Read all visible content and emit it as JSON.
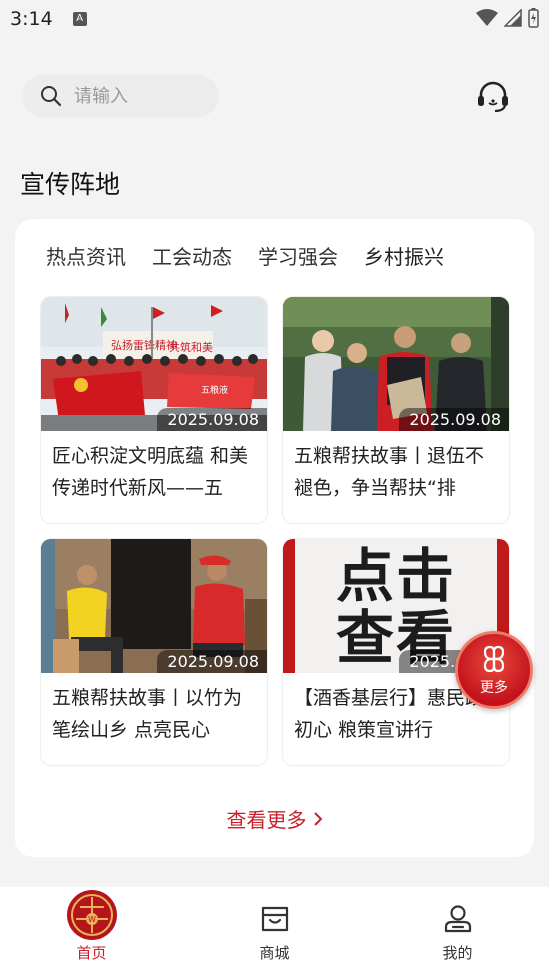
{
  "status_bar": {
    "time": "3:14",
    "notif_icon": "A"
  },
  "search": {
    "placeholder": "请输入"
  },
  "section": {
    "title": "宣传阵地"
  },
  "tabs": [
    {
      "label": "热点资讯",
      "active": false
    },
    {
      "label": "工会动态",
      "active": false
    },
    {
      "label": "学习强会",
      "active": false
    },
    {
      "label": "乡村振兴",
      "active": true
    }
  ],
  "news": [
    {
      "title": "匠心积淀文明底蕴 和美传递时代新风——五",
      "date": "2025.09.08",
      "image": "group-flag-photo"
    },
    {
      "title": "五粮帮扶故事丨退伍不褪色，争当帮扶“排",
      "date": "2025.09.08",
      "image": "village-visit-photo"
    },
    {
      "title": "五粮帮扶故事丨以竹为笔绘山乡 点亮民心",
      "date": "2025.09.08",
      "image": "elder-talk-photo"
    },
    {
      "title": "【酒香基层行】惠民践初心 粮策宣讲行",
      "date": "2025.09.08",
      "image": "click-to-view-banner",
      "banner_text": "点击查看"
    }
  ],
  "more": {
    "label": "查看更多"
  },
  "float_button": {
    "label": "更多"
  },
  "bottom_nav": [
    {
      "label": "首页",
      "icon": "home-logo-icon",
      "active": true
    },
    {
      "label": "商城",
      "icon": "store-icon",
      "active": false
    },
    {
      "label": "我的",
      "icon": "user-icon",
      "active": false
    }
  ],
  "colors": {
    "accent": "#c8202c",
    "background": "#f3f3f3"
  }
}
